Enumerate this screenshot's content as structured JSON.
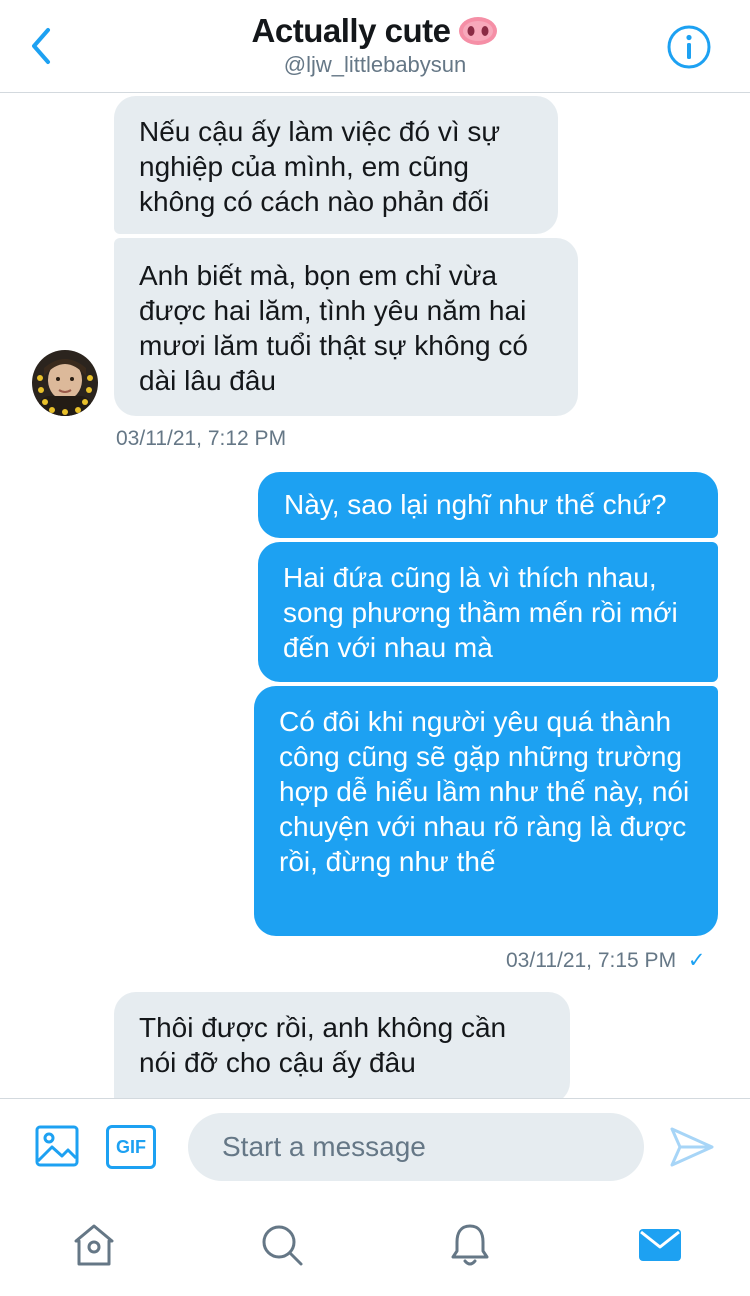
{
  "header": {
    "title": "Actually cute",
    "handle": "@ljw_littlebabysun",
    "icons": {
      "back": "chevron-left-icon",
      "info": "info-icon",
      "emoji": "pig-nose-emoji"
    }
  },
  "messages": [
    {
      "id": "m1",
      "direction": "incoming",
      "text": "Nếu cậu ấy làm việc đó vì sự nghiệp của mình, em cũng không có cách nào phản đối"
    },
    {
      "id": "m2",
      "direction": "incoming",
      "text": "Anh biết mà, bọn em chỉ vừa được hai lăm, tình yêu năm hai mươi lăm tuổi thật sự không có dài lâu đâu"
    },
    {
      "id": "t1",
      "type": "timestamp",
      "text": "03/11/21, 7:12 PM"
    },
    {
      "id": "m3",
      "direction": "outgoing",
      "text": "Này, sao lại nghĩ như thế chứ?"
    },
    {
      "id": "m4",
      "direction": "outgoing",
      "text": "Hai đứa cũng là vì thích nhau, song phương thầm mến rồi mới đến với nhau mà"
    },
    {
      "id": "m5",
      "direction": "outgoing",
      "text": "Có đôi khi người yêu quá thành công cũng sẽ gặp những trường hợp dễ hiểu lầm như thế này, nói chuyện với nhau rõ ràng là được rồi, đừng như thế"
    },
    {
      "id": "t2",
      "type": "timestamp",
      "text": "03/11/21, 7:15 PM",
      "status": "✓"
    },
    {
      "id": "m6",
      "direction": "incoming",
      "text": "Thôi được rồi, anh không cần nói đỡ cho cậu ấy đâu"
    }
  ],
  "composer": {
    "placeholder": "Start a message",
    "gif_label": "GIF",
    "icons": {
      "media": "image-icon",
      "send": "send-icon"
    }
  },
  "tabbar": {
    "items": [
      "home-icon",
      "search-icon",
      "bell-icon",
      "mail-icon"
    ],
    "active": "mail-icon"
  },
  "colors": {
    "accent": "#1da1f2",
    "incoming_bubble": "#e6ecf0",
    "secondary_text": "#657786",
    "divider": "#d3d9de"
  }
}
